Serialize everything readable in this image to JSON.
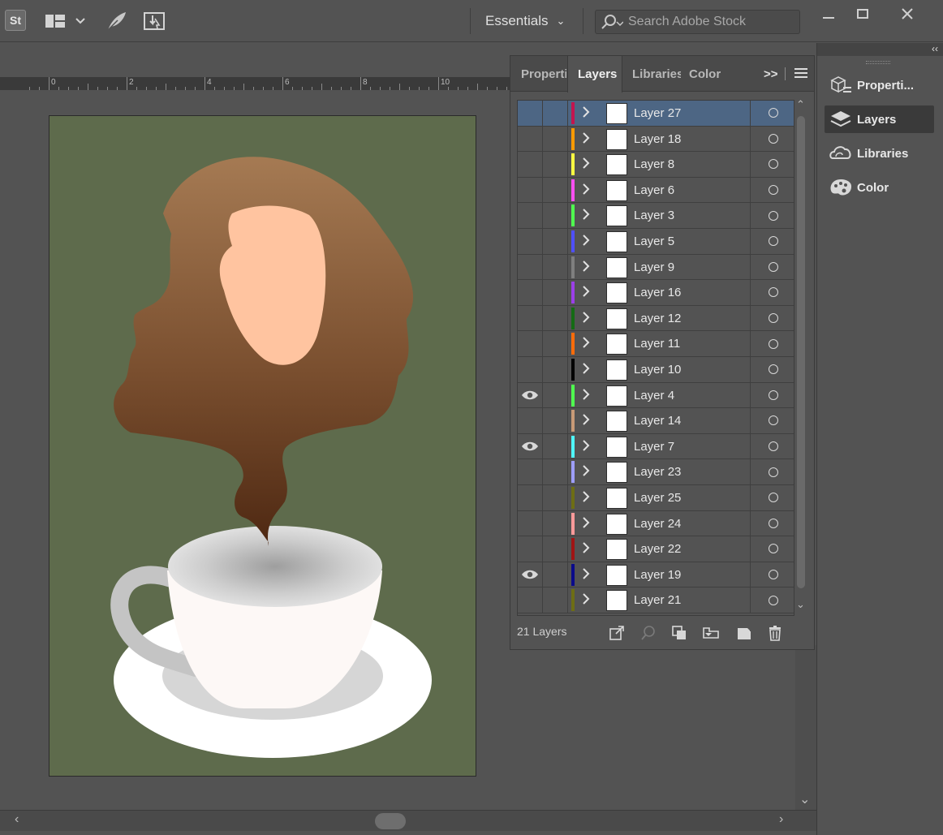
{
  "topbar": {
    "logo": "St",
    "workspace_label": "Essentials",
    "search_placeholder": "Search Adobe Stock",
    "icons": [
      "layout-icon",
      "feather-brush-icon",
      "arrange-document-icon"
    ]
  },
  "window_controls": {
    "minimize": "minimize-icon",
    "restore": "restore-icon",
    "close": "close-icon"
  },
  "ruler": {
    "labels": [
      "0",
      "2",
      "4",
      "6",
      "8",
      "10"
    ]
  },
  "layers_panel": {
    "tabs": [
      "Properti",
      "Layers",
      "Libraries",
      "Color"
    ],
    "active_tab": "Layers",
    "layer_count_label": "21 Layers",
    "layers": [
      {
        "name": "Layer 27",
        "color": "#c3144f",
        "visible": false,
        "selected": true
      },
      {
        "name": "Layer 18",
        "color": "#ff9a00",
        "visible": false
      },
      {
        "name": "Layer 8",
        "color": "#ffff42",
        "visible": false
      },
      {
        "name": "Layer 6",
        "color": "#ff4ff2",
        "visible": false
      },
      {
        "name": "Layer 3",
        "color": "#4fff4f",
        "visible": false
      },
      {
        "name": "Layer 5",
        "color": "#4f4fff",
        "visible": false
      },
      {
        "name": "Layer 9",
        "color": "#7f7f7f",
        "visible": false
      },
      {
        "name": "Layer 16",
        "color": "#9b3fe8",
        "visible": false
      },
      {
        "name": "Layer 12",
        "color": "#146b14",
        "visible": false
      },
      {
        "name": "Layer 11",
        "color": "#ff6c0a",
        "visible": false
      },
      {
        "name": "Layer 10",
        "color": "#000000",
        "visible": false
      },
      {
        "name": "Layer 4",
        "color": "#4fff4f",
        "visible": true
      },
      {
        "name": "Layer 14",
        "color": "#c89a77",
        "visible": false
      },
      {
        "name": "Layer 7",
        "color": "#4ff7ff",
        "visible": true
      },
      {
        "name": "Layer 23",
        "color": "#9e9eff",
        "visible": false
      },
      {
        "name": "Layer 25",
        "color": "#6e6e14",
        "visible": false
      },
      {
        "name": "Layer 24",
        "color": "#ff9a9a",
        "visible": false
      },
      {
        "name": "Layer 22",
        "color": "#a01414",
        "visible": false
      },
      {
        "name": "Layer 19",
        "color": "#0a0a8a",
        "visible": true
      },
      {
        "name": "Layer 21",
        "color": "#6e6e14",
        "visible": false
      }
    ]
  },
  "dock": {
    "items": [
      {
        "label": "Properti...",
        "icon": "properties-icon"
      },
      {
        "label": "Layers",
        "icon": "layers-icon",
        "active": true
      },
      {
        "label": "Libraries",
        "icon": "libraries-icon"
      },
      {
        "label": "Color",
        "icon": "color-palette-icon"
      }
    ]
  },
  "colors": {
    "artboard_bg": "#5e6b4c",
    "selection": "#4d6684",
    "ui_bg": "#535353"
  }
}
